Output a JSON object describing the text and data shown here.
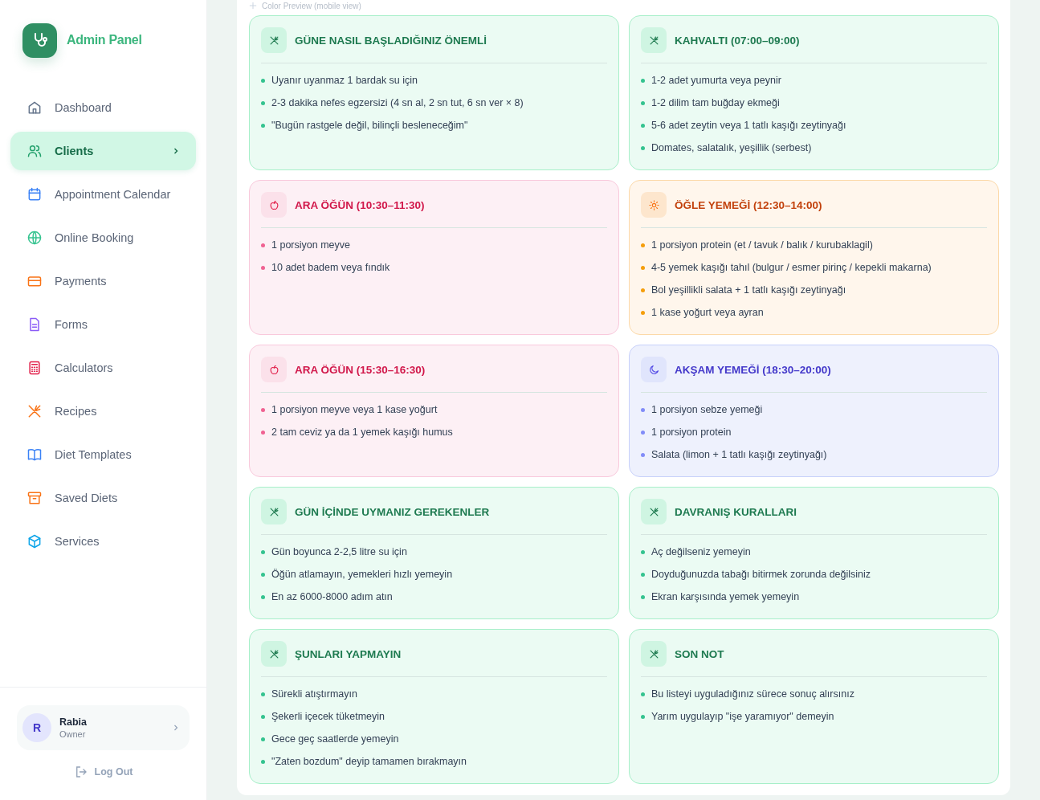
{
  "sidebar": {
    "brand": "Admin Panel",
    "items": [
      {
        "label": "Dashboard",
        "selected": false
      },
      {
        "label": "Clients",
        "selected": true
      },
      {
        "label": "Appointment Calendar",
        "selected": false
      },
      {
        "label": "Online Booking",
        "selected": false
      },
      {
        "label": "Payments",
        "selected": false
      },
      {
        "label": "Forms",
        "selected": false
      },
      {
        "label": "Calculators",
        "selected": false
      },
      {
        "label": "Recipes",
        "selected": false
      },
      {
        "label": "Diet Templates",
        "selected": false
      },
      {
        "label": "Saved Diets",
        "selected": false
      },
      {
        "label": "Services",
        "selected": false
      }
    ],
    "user": {
      "initial": "R",
      "name": "Rabia",
      "role": "Owner"
    },
    "logout": "Log Out"
  },
  "preview": {
    "caption": "Color Preview (mobile view)",
    "cards": [
      {
        "kind": "general",
        "title": "GÜNE NASIL BAŞLADIĞINIZ ÖNEMLİ",
        "items": [
          "Uyanır uyanmaz 1 bardak su için",
          "2-3 dakika nefes egzersizi (4 sn al, 2 sn tut, 6 sn ver × 8)",
          "\"Bugün rastgele değil, bilinçli besleneceğim\""
        ]
      },
      {
        "kind": "general",
        "title": "KAHVALTI (07:00–09:00)",
        "items": [
          "1-2 adet yumurta veya peynir",
          "1-2 dilim tam buğday ekmeği",
          "5-6 adet zeytin veya 1 tatlı kaşığı zeytinyağı",
          "Domates, salatalık, yeşillik (serbest)"
        ]
      },
      {
        "kind": "snack",
        "title": "ARA ÖĞÜN (10:30–11:30)",
        "items": [
          "1 porsiyon meyve",
          "10 adet badem veya fındık"
        ]
      },
      {
        "kind": "lunch",
        "title": "ÖĞLE YEMEĞİ (12:30–14:00)",
        "items": [
          "1 porsiyon protein (et / tavuk / balık / kurubaklagil)",
          "4-5 yemek kaşığı tahıl (bulgur / esmer pirinç / kepekli makarna)",
          "Bol yeşillikli salata + 1 tatlı kaşığı zeytinyağı",
          "1 kase yoğurt veya ayran"
        ]
      },
      {
        "kind": "snack",
        "title": "ARA ÖĞÜN (15:30–16:30)",
        "items": [
          "1 porsiyon meyve veya 1 kase yoğurt",
          "2 tam ceviz ya da 1 yemek kaşığı humus"
        ]
      },
      {
        "kind": "dinner",
        "title": "AKŞAM YEMEĞİ (18:30–20:00)",
        "items": [
          "1 porsiyon sebze yemeği",
          "1 porsiyon protein",
          "Salata (limon + 1 tatlı kaşığı zeytinyağı)"
        ]
      },
      {
        "kind": "general",
        "title": "GÜN İÇİNDE UYMANIZ GEREKENLER",
        "items": [
          "Gün boyunca 2-2,5 litre su için",
          "Öğün atlamayın, yemekleri hızlı yemeyin",
          "En az 6000-8000 adım atın"
        ]
      },
      {
        "kind": "general",
        "title": "DAVRANIŞ KURALLARI",
        "items": [
          "Aç değilseniz yemeyin",
          "Doyduğunuzda tabağı bitirmek zorunda değilsiniz",
          "Ekran karşısında yemek yemeyin"
        ]
      },
      {
        "kind": "general",
        "title": "ŞUNLARI YAPMAYIN",
        "items": [
          "Sürekli atıştırmayın",
          "Şekerli içecek tüketmeyin",
          "Gece geç saatlerde yemeyin",
          "\"Zaten bozdum\" deyip tamamen bırakmayın"
        ]
      },
      {
        "kind": "general",
        "title": "SON NOT",
        "items": [
          "Bu listeyi uyguladığınız sürece sonuç alırsınız",
          "Yarım uygulayıp \"işe yaramıyor\" demeyin"
        ]
      }
    ]
  }
}
